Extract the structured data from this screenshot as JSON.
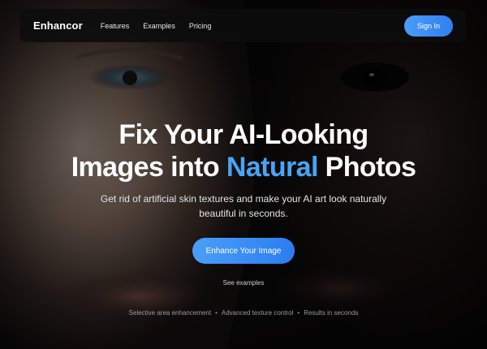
{
  "nav": {
    "logo": "Enhancor",
    "links": [
      "Features",
      "Examples",
      "Pricing"
    ],
    "signin_label": "Sign In"
  },
  "hero": {
    "headline_part1": "Fix Your AI-Looking",
    "headline_part2": "Images into ",
    "headline_accent": "Natural",
    "headline_part3": " Photos",
    "subtitle": "Get rid of artificial skin textures and make your AI art look naturally beautiful in seconds.",
    "cta_label": "Enhance Your Image",
    "secondary_link": "See examples",
    "features": [
      "Selective area enhancement",
      "Advanced texture control",
      "Results in seconds"
    ],
    "feature_separator": "•"
  },
  "colors": {
    "accent": "#46a5f5",
    "button_gradient_start": "#4a9ef9",
    "button_gradient_end": "#2c7df0",
    "nav_background": "#0c0c0e"
  }
}
